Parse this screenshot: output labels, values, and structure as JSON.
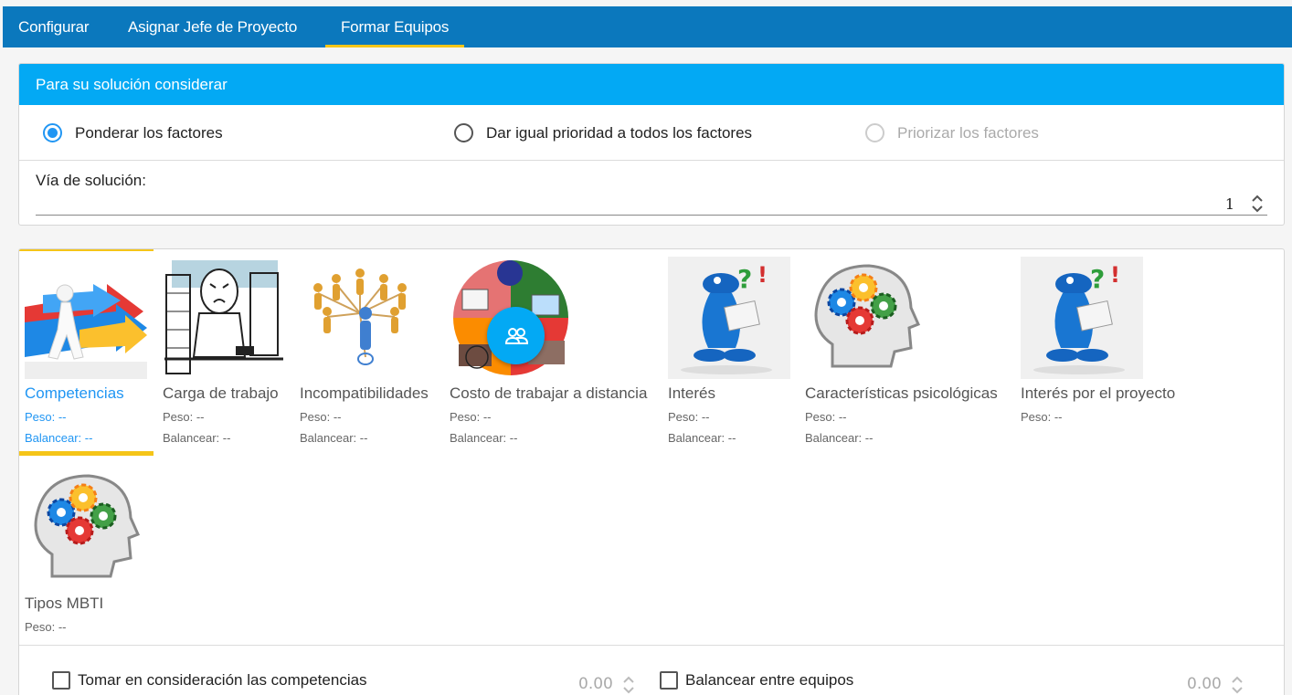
{
  "tabs": [
    {
      "label": "Configurar"
    },
    {
      "label": "Asignar Jefe de Proyecto"
    },
    {
      "label": "Formar Equipos"
    }
  ],
  "consider": {
    "title": "Para su solución considerar",
    "options": [
      {
        "label": "Ponderar los factores",
        "state": "checked"
      },
      {
        "label": "Dar igual prioridad a todos los factores",
        "state": "unchecked"
      },
      {
        "label": "Priorizar los factores",
        "state": "disabled"
      }
    ],
    "via_label": "Vía de solución:",
    "via_value": "1"
  },
  "factors": [
    {
      "name": "Competencias",
      "peso": "Peso: --",
      "balancear": "Balancear: --",
      "icon": "competencias-arrows-icon",
      "active": true
    },
    {
      "name": "Carga de trabajo",
      "peso": "Peso: --",
      "balancear": "Balancear: --",
      "icon": "workload-sketch-icon"
    },
    {
      "name": "Incompatibilidades",
      "peso": "Peso: --",
      "balancear": "Balancear: --",
      "icon": "network-people-icon"
    },
    {
      "name": "Costo de trabajar a distancia",
      "peso": "Peso: --",
      "balancear": "Balancear: --",
      "icon": "remote-work-icon"
    },
    {
      "name": "Interés",
      "peso": "Peso: --",
      "balancear": "Balancear: --",
      "icon": "question-figure-icon"
    },
    {
      "name": "Características psicológicas",
      "peso": "Peso: --",
      "balancear": "Balancear: --",
      "icon": "head-gears-icon"
    },
    {
      "name": "Interés por el proyecto",
      "peso": "Peso: --",
      "icon": "question-figure-icon"
    },
    {
      "name": "Tipos MBTI",
      "peso": "Peso: --",
      "icon": "head-gears-icon"
    }
  ],
  "fab": {
    "icon": "group-icon"
  },
  "options": {
    "competencias": {
      "label": "Tomar en consideración las competencias",
      "value": "0.00"
    },
    "balancear": {
      "label": "Balancear entre equipos",
      "value": "0.00"
    }
  },
  "colors": {
    "topbar": "#0b78bd",
    "header": "#03a9f4",
    "accent": "#2196f3",
    "indicator": "#f5c518"
  }
}
